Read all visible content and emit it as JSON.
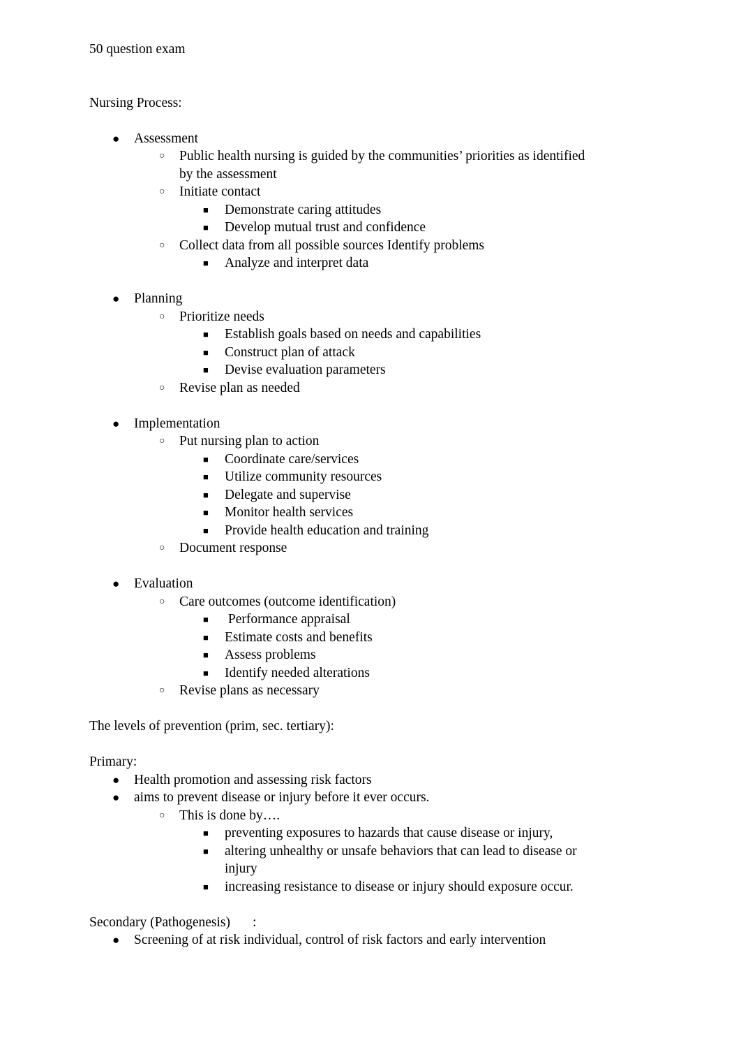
{
  "document": {
    "title": "50 question exam",
    "bullets": {
      "level1": "●",
      "level2": "○",
      "level3": "■"
    },
    "heading_nursing_process": "Nursing Process:",
    "nursing_process": [
      {
        "label": "Assessment",
        "children": [
          {
            "label": "Public health nursing is guided by the communities’ priorities as identified by the assessment",
            "children": []
          },
          {
            "label": "Initiate contact",
            "children": [
              {
                "label": "Demonstrate caring attitudes"
              },
              {
                "label": "Develop mutual trust and confidence"
              }
            ]
          },
          {
            "label": "Collect data from all possible sources Identify problems",
            "children": [
              {
                "label": "Analyze and interpret data"
              }
            ]
          }
        ]
      },
      {
        "label": "Planning",
        "children": [
          {
            "label": "Prioritize needs",
            "children": [
              {
                "label": "Establish goals based on needs and capabilities"
              },
              {
                "label": "Construct plan of attack"
              },
              {
                "label": "Devise evaluation parameters"
              }
            ]
          },
          {
            "label": "Revise plan as needed",
            "children": []
          }
        ]
      },
      {
        "label": "Implementation",
        "children": [
          {
            "label": "Put nursing plan to action",
            "children": [
              {
                "label": "Coordinate care/services"
              },
              {
                "label": "Utilize community resources"
              },
              {
                "label": "Delegate and supervise"
              },
              {
                "label": "Monitor health services"
              },
              {
                "label": "Provide health education and training"
              }
            ]
          },
          {
            "label": "Document response",
            "children": []
          }
        ]
      },
      {
        "label": "Evaluation",
        "children": [
          {
            "label": "Care outcomes (outcome identification)",
            "children": [
              {
                "label": " Performance appraisal"
              },
              {
                "label": "Estimate costs and benefits"
              },
              {
                "label": "Assess problems"
              },
              {
                "label": "Identify needed alterations"
              }
            ]
          },
          {
            "label": "Revise plans as necessary",
            "children": []
          }
        ]
      }
    ],
    "heading_levels_of_prevention": "The levels of prevention (prim, sec. tertiary):",
    "heading_primary": "Primary:",
    "primary": [
      {
        "label": "Health promotion and assessing risk factors",
        "children": []
      },
      {
        "label": "aims to prevent disease or injury before it ever occurs.",
        "children": [
          {
            "label": "This is done by….",
            "children": [
              {
                "label": "preventing exposures to hazards that cause disease or injury,"
              },
              {
                "label": "altering unhealthy or unsafe behaviors that can lead to disease or injury"
              },
              {
                "label": "increasing resistance to disease or injury should exposure occur."
              }
            ]
          }
        ]
      }
    ],
    "heading_secondary": "Secondary (Pathogenesis)\t:",
    "secondary": [
      {
        "label": "Screening of at risk individual, control of risk factors and early intervention",
        "children": []
      }
    ]
  }
}
